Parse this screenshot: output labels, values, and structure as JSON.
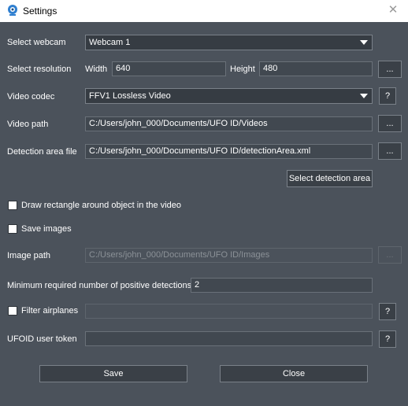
{
  "window": {
    "title": "Settings",
    "close_glyph": "✕",
    "app_icon": "webcam-icon"
  },
  "webcam": {
    "label": "Select webcam",
    "value": "Webcam 1"
  },
  "resolution": {
    "label": "Select resolution",
    "width_label": "Width",
    "width_value": "640",
    "height_label": "Height",
    "height_value": "480",
    "browse": "..."
  },
  "codec": {
    "label": "Video codec",
    "value": "FFV1 Lossless Video",
    "help": "?"
  },
  "video_path": {
    "label": "Video path",
    "value": "C:/Users/john_000/Documents/UFO ID/Videos",
    "browse": "..."
  },
  "detection_file": {
    "label": "Detection area file",
    "value": "C:/Users/john_000/Documents/UFO ID/detectionArea.xml",
    "browse": "..."
  },
  "select_area_button": "Select detection area",
  "draw_rect": {
    "label": "Draw rectangle around object in the video",
    "checked": false
  },
  "save_images": {
    "label": "Save images",
    "checked": false
  },
  "image_path": {
    "label": "Image path",
    "value": "C:/Users/john_000/Documents/UFO ID/Images",
    "browse": "..."
  },
  "min_detections": {
    "label": "Minimum required number of positive detections",
    "value": "2"
  },
  "filter_airplanes": {
    "label": "Filter airplanes",
    "checked": false,
    "value": "",
    "help": "?"
  },
  "user_token": {
    "label": "UFOID user token",
    "value": "",
    "help": "?"
  },
  "buttons": {
    "save": "Save",
    "close": "Close"
  }
}
